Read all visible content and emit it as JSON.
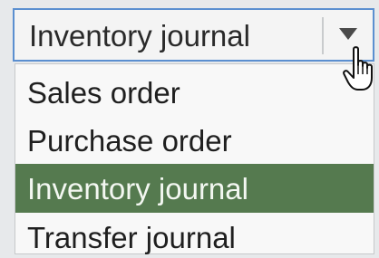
{
  "combo": {
    "selected_value": "Inventory journal",
    "arrow_icon": "chevron-down-icon"
  },
  "dropdown": {
    "options": [
      {
        "label": "Sales order",
        "selected": false
      },
      {
        "label": "Purchase order",
        "selected": false
      },
      {
        "label": "Inventory journal",
        "selected": true
      },
      {
        "label": "Transfer journal",
        "selected": false
      }
    ]
  },
  "colors": {
    "focus_border": "#5b8fd0",
    "selected_background": "#557a4f",
    "selected_text": "#f3f7f1",
    "text": "#1f1f1f"
  },
  "cursor": {
    "icon": "hand-pointer-icon"
  }
}
